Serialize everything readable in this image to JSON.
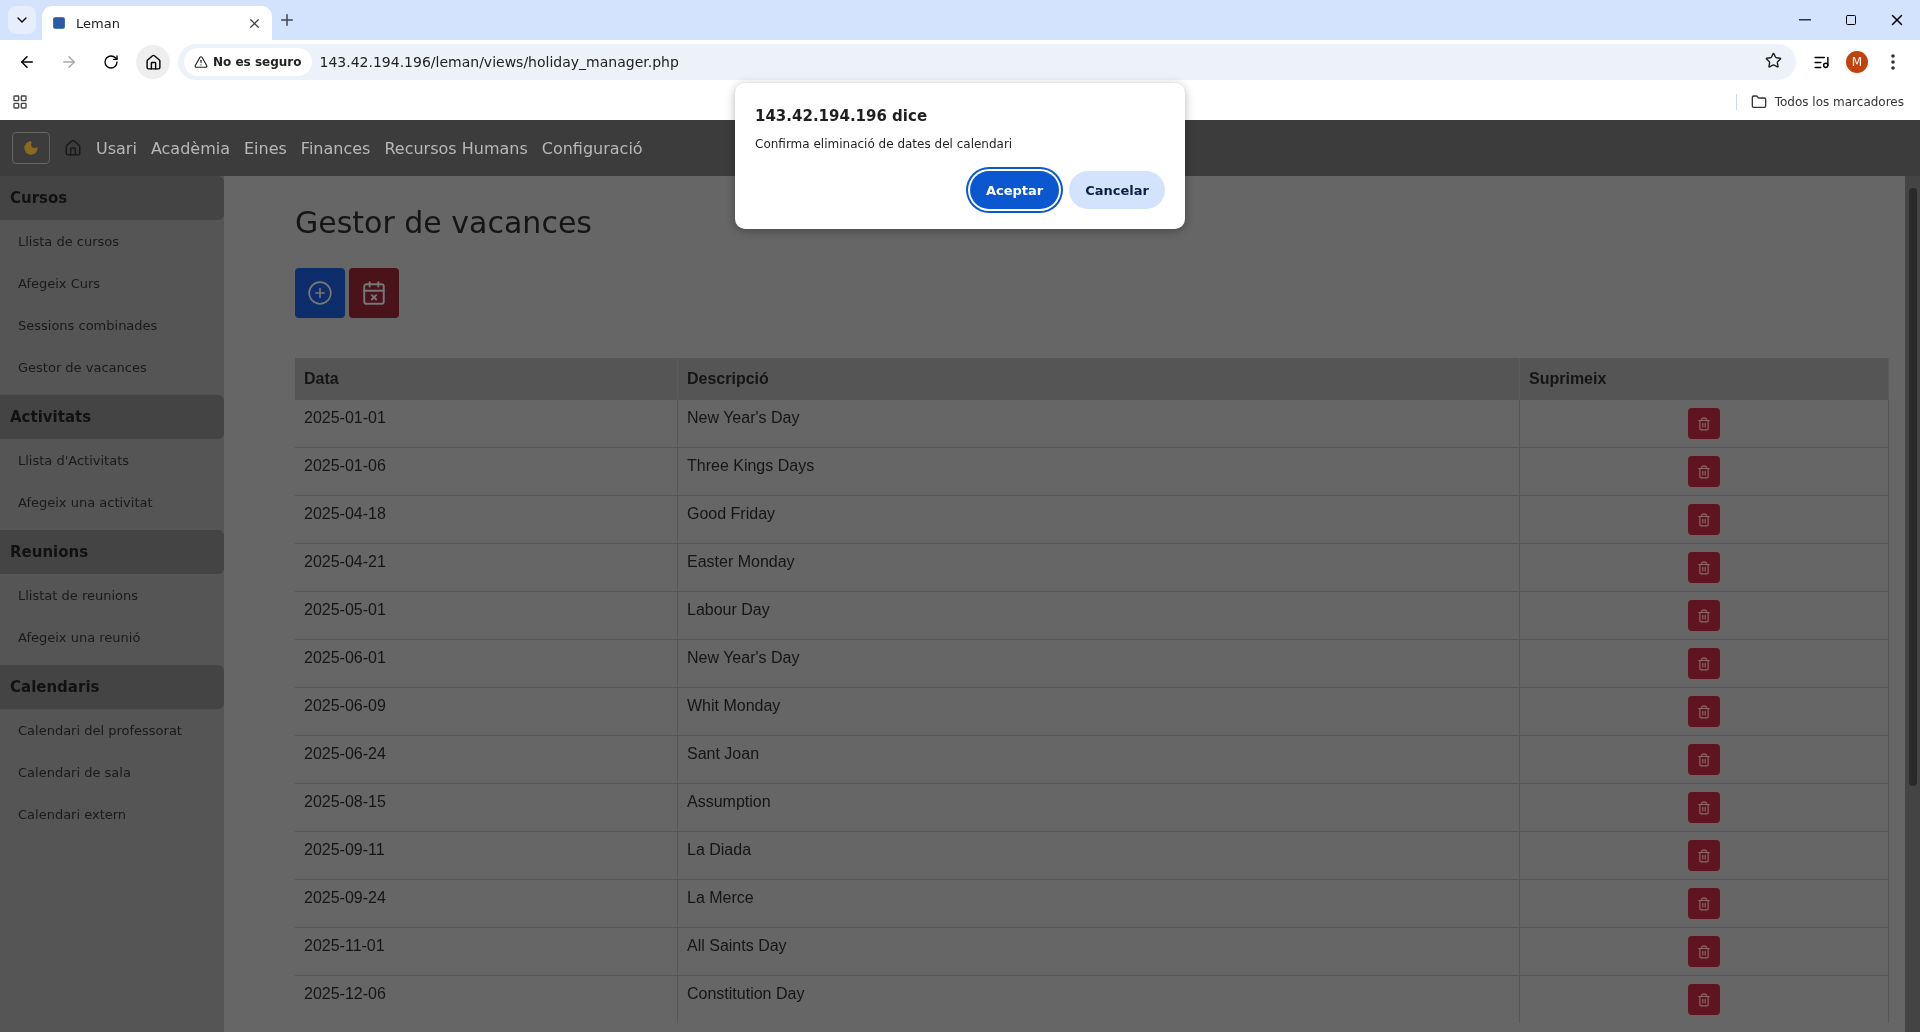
{
  "browser": {
    "tabs": [
      {
        "title": "Leman",
        "selected": true
      }
    ],
    "security_label": "No es seguro",
    "url": "143.42.194.196/leman/views/holiday_manager.php",
    "profile_initial": "M",
    "bookmarks_label": "Todos los marcadores"
  },
  "navbar": {
    "items": [
      "Usari",
      "Acadèmia",
      "Eines",
      "Finances",
      "Recursos Humans",
      "Configuració"
    ]
  },
  "sidebar": {
    "sections": [
      {
        "title": "Cursos",
        "items": [
          "Llista de cursos",
          "Afegeix Curs",
          "Sessions combinades",
          "Gestor de vacances"
        ]
      },
      {
        "title": "Activitats",
        "items": [
          "Llista d'Activitats",
          "Afegeix una activitat"
        ]
      },
      {
        "title": "Reunions",
        "items": [
          "Llistat de reunions",
          "Afegeix una reunió"
        ]
      },
      {
        "title": "Calendaris",
        "items": [
          "Calendari del professorat",
          "Calendari de sala",
          "Calendari extern"
        ]
      }
    ]
  },
  "page": {
    "title": "Gestor de vacances",
    "table": {
      "columns": [
        "Data",
        "Descripció",
        "Suprimeix"
      ],
      "rows": [
        {
          "date": "2025-01-01",
          "description": "New Year's Day"
        },
        {
          "date": "2025-01-06",
          "description": "Three Kings Days"
        },
        {
          "date": "2025-04-18",
          "description": "Good Friday"
        },
        {
          "date": "2025-04-21",
          "description": "Easter Monday"
        },
        {
          "date": "2025-05-01",
          "description": "Labour Day"
        },
        {
          "date": "2025-06-01",
          "description": "New Year's Day"
        },
        {
          "date": "2025-06-09",
          "description": "Whit Monday"
        },
        {
          "date": "2025-06-24",
          "description": "Sant Joan"
        },
        {
          "date": "2025-08-15",
          "description": "Assumption"
        },
        {
          "date": "2025-09-11",
          "description": "La Diada"
        },
        {
          "date": "2025-09-24",
          "description": "La Merce"
        },
        {
          "date": "2025-11-01",
          "description": "All Saints Day"
        },
        {
          "date": "2025-12-06",
          "description": "Constitution Day"
        }
      ]
    }
  },
  "dialog": {
    "title": "143.42.194.196 dice",
    "message": "Confirma eliminació de dates del calendari",
    "buttons": [
      {
        "label": "Aceptar",
        "kind": "primary"
      },
      {
        "label": "Cancelar",
        "kind": "secondary"
      }
    ]
  }
}
